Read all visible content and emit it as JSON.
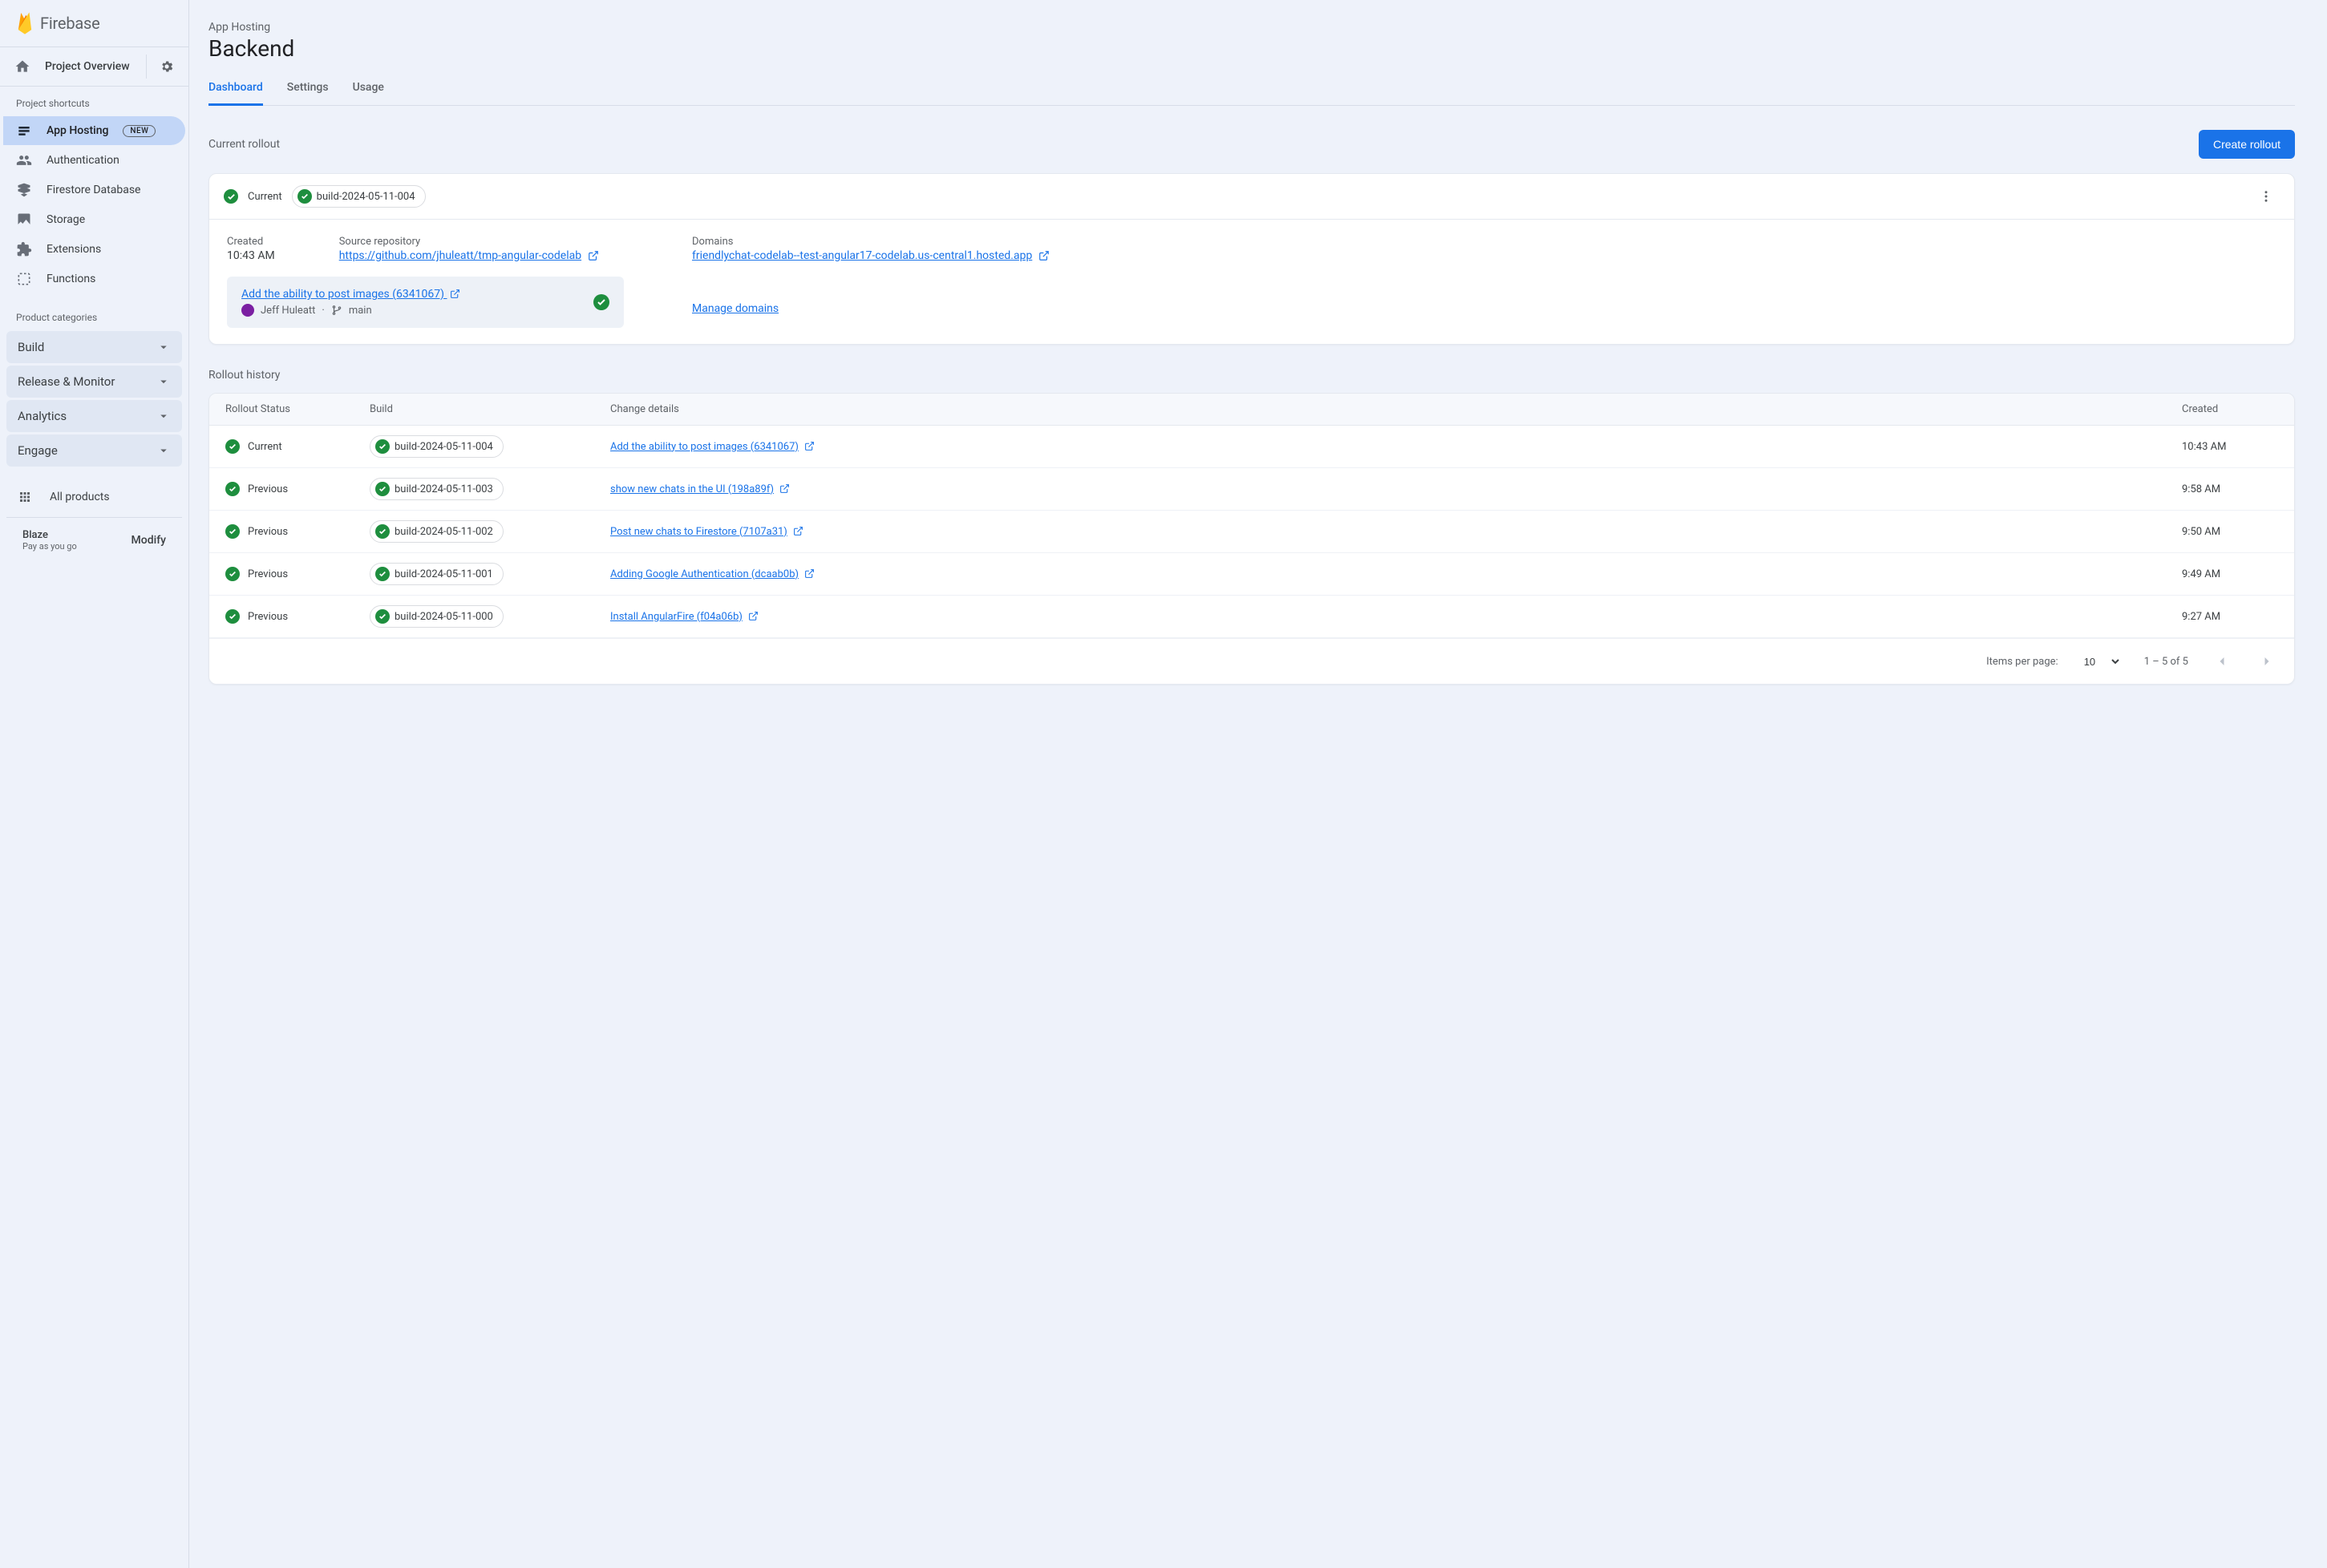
{
  "brand": {
    "name": "Firebase"
  },
  "overview": {
    "label": "Project Overview"
  },
  "shortcuts_label": "Project shortcuts",
  "nav": {
    "app_hosting": {
      "label": "App Hosting",
      "badge": "NEW"
    },
    "authentication": "Authentication",
    "firestore": "Firestore Database",
    "storage": "Storage",
    "extensions": "Extensions",
    "functions": "Functions"
  },
  "categories_label": "Product categories",
  "categories": {
    "build": "Build",
    "release": "Release & Monitor",
    "analytics": "Analytics",
    "engage": "Engage"
  },
  "all_products": "All products",
  "plan": {
    "tier": "Blaze",
    "sub": "Pay as you go",
    "modify": "Modify"
  },
  "breadcrumb": "App Hosting",
  "page_title": "Backend",
  "tabs": {
    "dashboard": "Dashboard",
    "settings": "Settings",
    "usage": "Usage"
  },
  "section": {
    "current_rollout": "Current rollout",
    "create_button": "Create rollout"
  },
  "current": {
    "status": "Current",
    "build_id": "build-2024-05-11-004",
    "created_label": "Created",
    "created_time": "10:43 AM",
    "source_label": "Source repository",
    "source_url": "https://github.com/jhuleatt/tmp-angular-codelab",
    "domains_label": "Domains",
    "domain_url": "friendlychat-codelab--test-angular17-codelab.us-central1.hosted.app",
    "manage_domains": "Manage domains",
    "commit_title": "Add the ability to post images (6341067)",
    "commit_author": "Jeff Huleatt",
    "commit_branch": "main"
  },
  "history": {
    "title": "Rollout history",
    "cols": {
      "status": "Rollout Status",
      "build": "Build",
      "change": "Change details",
      "created": "Created"
    },
    "rows": [
      {
        "status": "Current",
        "build": "build-2024-05-11-004",
        "change": "Add the ability to post images (6341067)",
        "created": "10:43 AM"
      },
      {
        "status": "Previous",
        "build": "build-2024-05-11-003",
        "change": "show new chats in the UI (198a89f)",
        "created": "9:58 AM"
      },
      {
        "status": "Previous",
        "build": "build-2024-05-11-002",
        "change": "Post new chats to Firestore (7107a31)",
        "created": "9:50 AM"
      },
      {
        "status": "Previous",
        "build": "build-2024-05-11-001",
        "change": "Adding Google Authentication (dcaab0b)",
        "created": "9:49 AM"
      },
      {
        "status": "Previous",
        "build": "build-2024-05-11-000",
        "change": "Install AngularFire (f04a06b)",
        "created": "9:27 AM"
      }
    ]
  },
  "pager": {
    "label": "Items per page:",
    "size": "10",
    "range": "1 – 5 of 5"
  }
}
